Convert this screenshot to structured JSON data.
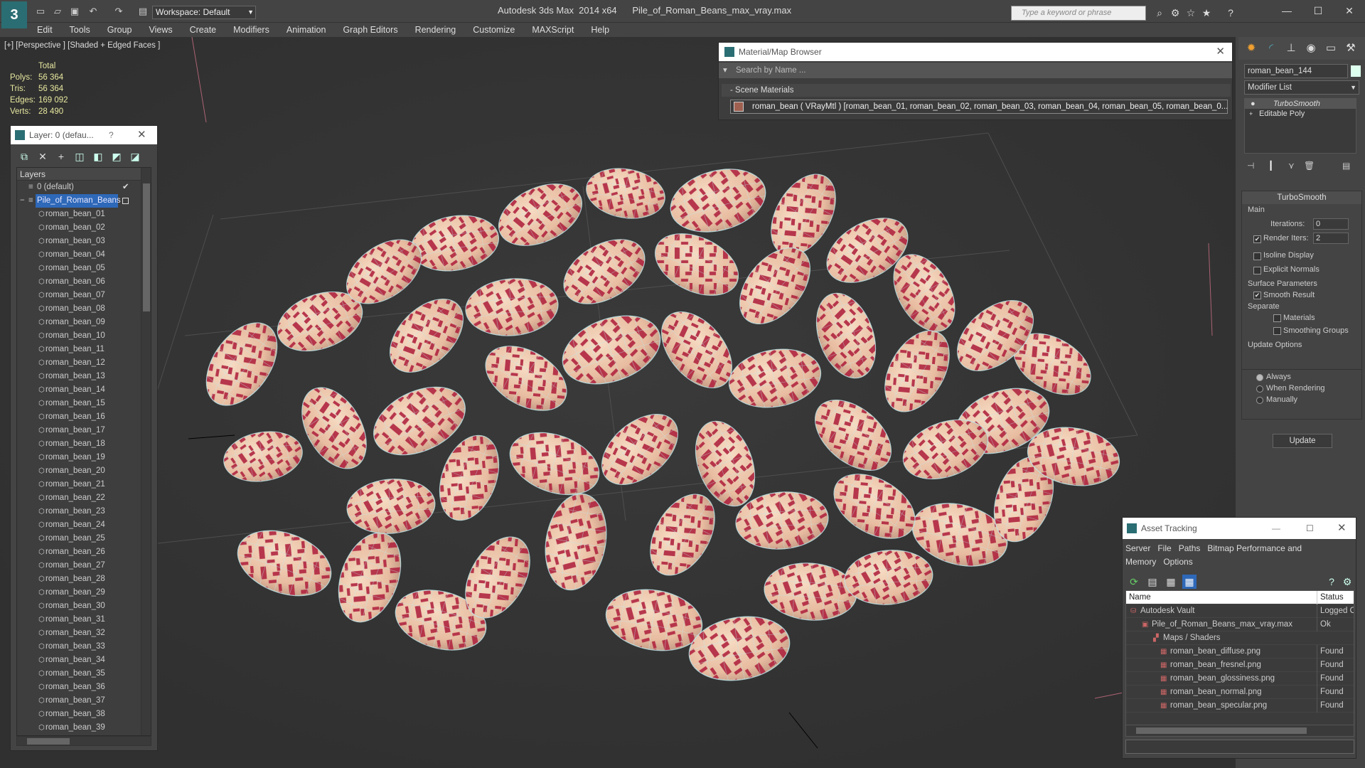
{
  "app": {
    "title": "Autodesk 3ds Max  2014 x64      Pile_of_Roman_Beans_max_vray.max",
    "workspace": "Workspace: Default",
    "search_placeholder": "Type a keyword or phrase"
  },
  "menu": [
    "Edit",
    "Tools",
    "Group",
    "Views",
    "Create",
    "Modifiers",
    "Animation",
    "Graph Editors",
    "Rendering",
    "Customize",
    "MAXScript",
    "Help"
  ],
  "viewport": {
    "label": "[+] [Perspective ] [Shaded + Edged Faces ]",
    "stats_header": "Total",
    "stats": [
      {
        "k": "Polys:",
        "v": "56 364"
      },
      {
        "k": "Tris:",
        "v": "56 364"
      },
      {
        "k": "Edges:",
        "v": "169 092"
      },
      {
        "k": "Verts:",
        "v": "28 490"
      }
    ]
  },
  "layer_window": {
    "title": "Layer: 0 (defau...",
    "help": "?",
    "header": "Layers",
    "default_layer": "0 (default)",
    "selected_layer": "Pile_of_Roman_Beans",
    "items": [
      "roman_bean_01",
      "roman_bean_02",
      "roman_bean_03",
      "roman_bean_04",
      "roman_bean_05",
      "roman_bean_06",
      "roman_bean_07",
      "roman_bean_08",
      "roman_bean_09",
      "roman_bean_10",
      "roman_bean_11",
      "roman_bean_12",
      "roman_bean_13",
      "roman_bean_14",
      "roman_bean_15",
      "roman_bean_16",
      "roman_bean_17",
      "roman_bean_18",
      "roman_bean_19",
      "roman_bean_20",
      "roman_bean_21",
      "roman_bean_22",
      "roman_bean_23",
      "roman_bean_24",
      "roman_bean_25",
      "roman_bean_26",
      "roman_bean_27",
      "roman_bean_28",
      "roman_bean_29",
      "roman_bean_30",
      "roman_bean_31",
      "roman_bean_32",
      "roman_bean_33",
      "roman_bean_34",
      "roman_bean_35",
      "roman_bean_36",
      "roman_bean_37",
      "roman_bean_38",
      "roman_bean_39"
    ]
  },
  "material_browser": {
    "title": "Material/Map Browser",
    "search": "Search by Name ...",
    "section": "- Scene Materials",
    "item": "roman_bean  ( VRayMtl )  [roman_bean_01, roman_bean_02, roman_bean_03, roman_bean_04, roman_bean_05, roman_bean_0..."
  },
  "command_panel": {
    "object_name": "roman_bean_144",
    "modifier_list": "Modifier List",
    "stack": [
      "TurboSmooth",
      "Editable Poly"
    ],
    "rollout_title": "TurboSmooth",
    "main": "Main",
    "iterations_label": "Iterations:",
    "iterations": "0",
    "render_iters_label": "Render Iters:",
    "render_iters": "2",
    "isoline": "Isoline Display",
    "explicit_normals": "Explicit Normals",
    "surface_params": "Surface Parameters",
    "smooth_result": "Smooth Result",
    "separate": "Separate",
    "materials": "Materials",
    "smoothing_groups": "Smoothing Groups",
    "update_options": "Update Options",
    "always": "Always",
    "when_rendering": "When Rendering",
    "manually": "Manually",
    "update_btn": "Update"
  },
  "asset_tracking": {
    "title": "Asset Tracking",
    "menu": [
      "Server",
      "File",
      "Paths",
      "Bitmap Performance and Memory",
      "Options"
    ],
    "col_name": "Name",
    "col_status": "Status",
    "rows": [
      {
        "name": "Autodesk Vault",
        "status": "Logged O"
      },
      {
        "name": "Pile_of_Roman_Beans_max_vray.max",
        "status": "Ok"
      },
      {
        "name": "Maps / Shaders",
        "status": ""
      },
      {
        "name": "roman_bean_diffuse.png",
        "status": "Found"
      },
      {
        "name": "roman_bean_fresnel.png",
        "status": "Found"
      },
      {
        "name": "roman_bean_glossiness.png",
        "status": "Found"
      },
      {
        "name": "roman_bean_normal.png",
        "status": "Found"
      },
      {
        "name": "roman_bean_specular.png",
        "status": "Found"
      }
    ]
  }
}
